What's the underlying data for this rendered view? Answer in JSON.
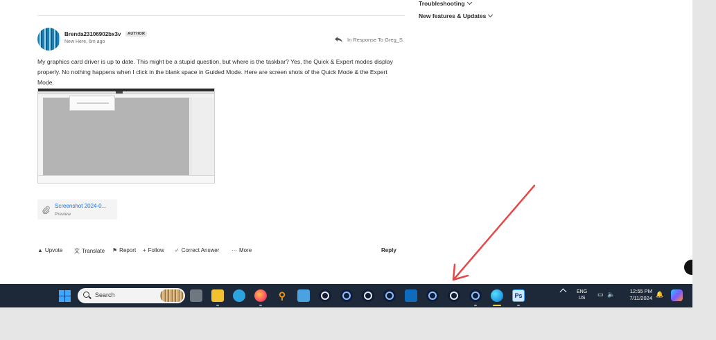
{
  "rail": {
    "items": [
      {
        "label": "Troubleshooting"
      },
      {
        "label": "New features & Updates"
      }
    ]
  },
  "post": {
    "author": "Brenda23106902bx3v",
    "badge": "AUTHOR",
    "meta": "New Here, 6m ago",
    "in_response": "In Response To Greg_S.",
    "body": "My graphics card driver is up to date. This might be a stupid question, but where is the taskbar? Yes, the Quick & Expert modes display properly. No nothing happens when I click in the blank space in Guided Mode. Here are screen shots of the Quick Mode & the Expert Mode."
  },
  "attachment": {
    "name": "Screenshot 2024-0...",
    "sub": "Preview"
  },
  "actions": {
    "upvote": "Upvote",
    "translate": "Translate",
    "report": "Report",
    "follow": "Follow",
    "correct": "Correct Answer",
    "more": "More",
    "reply": "Reply"
  },
  "taskbar": {
    "search_placeholder": "Search",
    "pinned": [
      {
        "name": "task-view-icon"
      },
      {
        "name": "file-explorer-icon"
      },
      {
        "name": "telegram-icon"
      },
      {
        "name": "firefox-icon"
      },
      {
        "name": "search-tool-icon"
      },
      {
        "name": "photos-icon"
      },
      {
        "name": "obs-icon"
      },
      {
        "name": "obs-icon"
      },
      {
        "name": "obs-icon"
      },
      {
        "name": "obs-icon"
      },
      {
        "name": "outlook-icon"
      },
      {
        "name": "obs-icon"
      },
      {
        "name": "obs-icon"
      },
      {
        "name": "obs-icon"
      },
      {
        "name": "edge-icon"
      },
      {
        "name": "photoshop-icon"
      }
    ],
    "ps_label": "Ps",
    "lang_line1": "ENG",
    "lang_line2": "US",
    "time": "12:55 PM",
    "date": "7/11/2024"
  },
  "colors": {
    "link": "#1473e6",
    "taskbar": "#1d2938",
    "annotation": "#e54848"
  }
}
